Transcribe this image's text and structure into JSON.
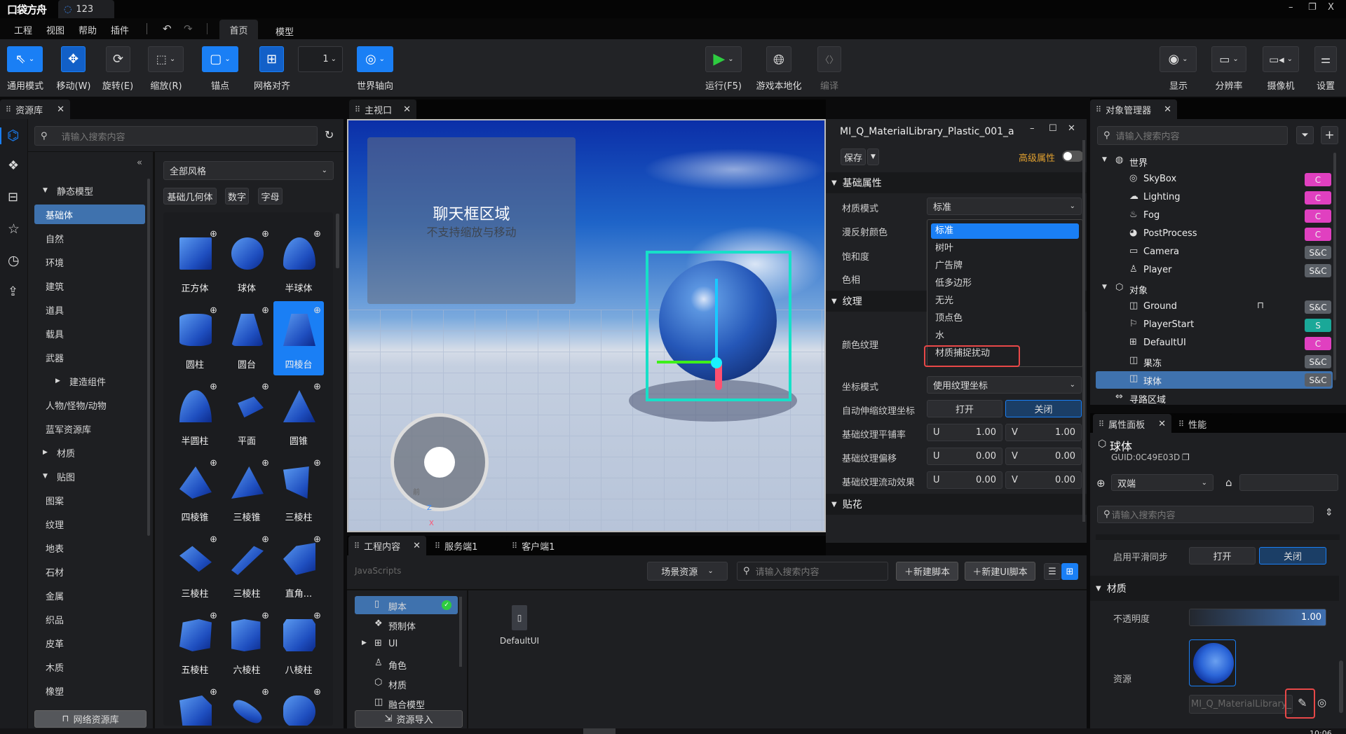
{
  "titlebar": {
    "logo": "口袋方舟",
    "project_tab": "123"
  },
  "menu": {
    "items": [
      "工程",
      "视图",
      "帮助",
      "插件"
    ],
    "tabs": [
      "首页",
      "模型"
    ]
  },
  "toolbar": {
    "left": [
      {
        "label": "通用模式",
        "icon": "cursor-icon"
      },
      {
        "label": "移动(W)",
        "icon": "move-icon"
      },
      {
        "label": "旋转(E)",
        "icon": "rotate-icon"
      },
      {
        "label": "缩放(R)",
        "icon": "scale-icon"
      },
      {
        "label": "锚点",
        "icon": "anchor-icon"
      },
      {
        "label": "网格对齐",
        "icon": "grid-icon"
      },
      {
        "label": "1",
        "icon": "number-dropdown"
      },
      {
        "label": "世界轴向",
        "icon": "world-axis-icon"
      }
    ],
    "center": [
      {
        "label": "运行(F5)",
        "icon": "play-icon"
      },
      {
        "label": "游戏本地化",
        "icon": "globe-icon"
      },
      {
        "label": "编译",
        "icon": "code-icon"
      }
    ],
    "right": [
      {
        "label": "显示",
        "icon": "eye-icon"
      },
      {
        "label": "分辨率",
        "icon": "monitor-icon"
      },
      {
        "label": "摄像机",
        "icon": "camera-icon"
      },
      {
        "label": "设置",
        "icon": "sliders-icon"
      }
    ],
    "run_color": "#2ecc40",
    "accent": "#1a7ff5"
  },
  "assets": {
    "tab": "资源库",
    "search_placeholder": "请输入搜索内容",
    "tree": [
      {
        "label": "静态模型",
        "level": 0,
        "arrow": "down"
      },
      {
        "label": "基础体",
        "level": 1,
        "selected": true
      },
      {
        "label": "自然",
        "level": 1
      },
      {
        "label": "环境",
        "level": 1
      },
      {
        "label": "建筑",
        "level": 1
      },
      {
        "label": "道具",
        "level": 1
      },
      {
        "label": "载具",
        "level": 1
      },
      {
        "label": "武器",
        "level": 1
      },
      {
        "label": "建造组件",
        "level": 2,
        "arrow": "right"
      },
      {
        "label": "人物/怪物/动物",
        "level": 1
      },
      {
        "label": "蓝军资源库",
        "level": 1
      },
      {
        "label": "材质",
        "level": 0,
        "arrow": "right"
      },
      {
        "label": "贴图",
        "level": 0,
        "arrow": "down"
      },
      {
        "label": "图案",
        "level": 1
      },
      {
        "label": "纹理",
        "level": 1
      },
      {
        "label": "地表",
        "level": 1
      },
      {
        "label": "石材",
        "level": 1
      },
      {
        "label": "金属",
        "level": 1
      },
      {
        "label": "织品",
        "level": 1
      },
      {
        "label": "皮革",
        "level": 1
      },
      {
        "label": "木质",
        "level": 1
      },
      {
        "label": "橡塑",
        "level": 1
      }
    ],
    "network_button": "网络资源库",
    "style_select": "全部风格",
    "chips": [
      "基础几何体",
      "数字",
      "字母"
    ],
    "items": [
      "正方体",
      "球体",
      "半球体",
      "圆柱",
      "圆台",
      "四棱台",
      "半圆柱",
      "平面",
      "圆锥",
      "四棱锥",
      "三棱锥",
      "三棱柱",
      "三棱柱",
      "三棱柱",
      "直角...",
      "五棱柱",
      "六棱柱",
      "八棱柱",
      "",
      "",
      ""
    ],
    "selected_item": "四棱台"
  },
  "viewport": {
    "tab": "主视口",
    "chat_title": "聊天框区域",
    "chat_subtitle": "不支持缩放与移动",
    "gizmo_labels": {
      "z": "Z",
      "x": "X",
      "front": "前"
    }
  },
  "material_editor": {
    "title": "MI_Q_MaterialLibrary_Plastic_001_a",
    "save": "保存",
    "advanced": "高级属性",
    "advanced_on": false,
    "sections": {
      "basic": "基础属性",
      "texture": "纹理",
      "decal": "贴花"
    },
    "labels": {
      "mode": "材质模式",
      "diffuse": "漫反射颜色",
      "saturation": "饱和度",
      "hue": "色相",
      "color_texture": "颜色纹理",
      "coord_mode": "坐标模式",
      "auto_scale": "自动伸缩纹理坐标",
      "tiling": "基础纹理平铺率",
      "offset": "基础纹理偏移",
      "flow": "基础纹理流动效果"
    },
    "mode_value": "标准",
    "coord_value": "使用纹理坐标",
    "mode_options": [
      "标准",
      "树叶",
      "广告牌",
      "低多边形",
      "无光",
      "顶点色",
      "水",
      "材质捕捉扰动"
    ],
    "highlighted_option": "材质捕捉扰动",
    "on": "打开",
    "off": "关闭",
    "tiling": {
      "u": "1.00",
      "v": "1.00"
    },
    "offset": {
      "u": "0.00",
      "v": "0.00"
    },
    "flow": {
      "u": "0.00",
      "v": "0.00"
    }
  },
  "object_manager": {
    "tab": "对象管理器",
    "search_placeholder": "请输入搜索内容",
    "items": [
      {
        "label": "世界",
        "level": 0,
        "icon": "world-icon",
        "arrow": true
      },
      {
        "label": "SkyBox",
        "level": 1,
        "icon": "skybox-icon",
        "badge": "C"
      },
      {
        "label": "Lighting",
        "level": 1,
        "icon": "cloud-icon",
        "badge": "C"
      },
      {
        "label": "Fog",
        "level": 1,
        "icon": "fog-icon",
        "badge": "C"
      },
      {
        "label": "PostProcess",
        "level": 1,
        "icon": "palette-icon",
        "badge": "C"
      },
      {
        "label": "Camera",
        "level": 1,
        "icon": "camera-icon",
        "badge": "S&C"
      },
      {
        "label": "Player",
        "level": 1,
        "icon": "player-icon",
        "badge": "S&C"
      },
      {
        "label": "对象",
        "level": 0,
        "icon": "cube-icon",
        "arrow": true
      },
      {
        "label": "Ground",
        "level": 1,
        "icon": "box-icon",
        "badge": "S&C",
        "locked": true
      },
      {
        "label": "PlayerStart",
        "level": 1,
        "icon": "flag-icon",
        "badge": "S"
      },
      {
        "label": "DefaultUI",
        "level": 1,
        "icon": "ui-icon",
        "badge": "C"
      },
      {
        "label": "果冻",
        "level": 1,
        "icon": "box-icon",
        "badge": "S&C"
      },
      {
        "label": "球体",
        "level": 1,
        "icon": "box-icon",
        "badge": "S&C",
        "selected": true
      },
      {
        "label": "寻路区域",
        "level": 0,
        "icon": "navmesh-icon"
      }
    ],
    "badge_colors": {
      "C": "#e040c0",
      "S&C": "#5a5f66",
      "S": "#1aa898"
    }
  },
  "properties": {
    "tabs": [
      "属性面板",
      "性能"
    ],
    "name": "球体",
    "guid": "GUID:0C49E03D",
    "net_mode": "双端",
    "tag_value": "",
    "search_placeholder": "请输入搜索内容",
    "smooth_sync": "启用平滑同步",
    "on": "打开",
    "off": "关闭",
    "material_section": "材质",
    "opacity_label": "不透明度",
    "opacity": "1.00",
    "opacity_fraction": 1.0,
    "resource_label": "资源",
    "resource_name": "MI_Q_MaterialLibrary_Pla"
  },
  "project": {
    "tabs": [
      "工程内容",
      "服务端1",
      "客户端1"
    ],
    "path": "JavaScripts",
    "scene_select": "场景资源",
    "search_placeholder": "请输入搜索内容",
    "new_script": "新建脚本",
    "new_ui_script": "新建UI脚本",
    "categories": [
      {
        "label": "脚本",
        "icon": "file-icon",
        "selected": true
      },
      {
        "label": "预制体",
        "icon": "prefab-icon"
      },
      {
        "label": "UI",
        "icon": "ui-icon",
        "arrow": true
      },
      {
        "label": "角色",
        "icon": "character-icon"
      },
      {
        "label": "材质",
        "icon": "material-icon"
      },
      {
        "label": "融合模型",
        "icon": "box-icon"
      }
    ],
    "import_button": "资源导入",
    "files": [
      "DefaultUI"
    ]
  },
  "status": {
    "clock_partial": "10:06"
  }
}
